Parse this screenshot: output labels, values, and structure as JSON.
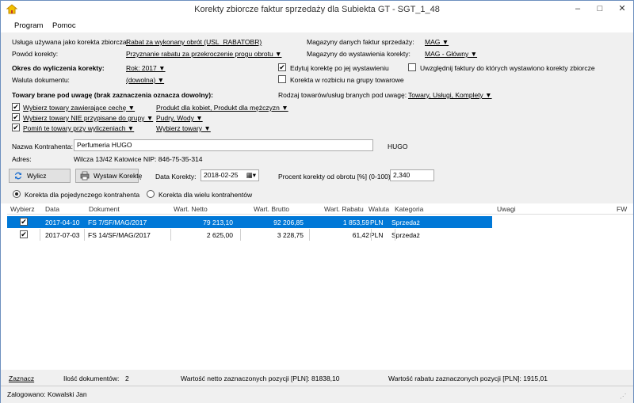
{
  "window": {
    "title": "Korekty zbiorcze faktur sprzedaży dla Subiekta GT - SGT_1_48",
    "minimize": "–",
    "maximize": "□",
    "close": "✕"
  },
  "menu": {
    "items": [
      "Program",
      "Pomoc"
    ]
  },
  "form": {
    "usluga_label": "Usługa używana jako korekta zbiorcza:",
    "usluga_value": "Rabat za wykonany obrót (USL_RABATOBR)",
    "powod_label": "Powód korekty:",
    "powod_value": "Przyznanie rabatu za przekroczenie progu obrotu ▼",
    "okres_label": "Okres do wyliczenia korekty:",
    "okres_value": "Rok: 2017 ▼",
    "waluta_label": "Waluta dokumentu:",
    "waluta_value": "(dowolna) ▼",
    "magazyny_danych_label": "Magazyny danych faktur sprzedaży:",
    "magazyny_danych_value": "MAG ▼",
    "magazyny_wyst_label": "Magazyny do wystawienia korekty:",
    "magazyny_wyst_value": "MAG - Główny ▼",
    "edytuj_label": "Edytuj korektę po jej wystawieniu",
    "edytuj_checked": true,
    "rozbicie_label": "Korekta w rozbiciu na grupy towarowe",
    "rozbicie_checked": false,
    "uwzglednij_label": "Uwzględnij faktury do których wystawiono korekty zbiorcze",
    "uwzglednij_checked": false,
    "towary_header": "Towary brane pod uwagę (brak zaznaczenia oznacza dowolny):",
    "rodzaj_label": "Rodzaj towarów/usług branych pod uwagę:",
    "rodzaj_value": "Towary, Usługi, Komplety ▼",
    "filters": [
      {
        "label": "Wybierz towary zawierające cechę ▼",
        "checked": true,
        "value": "Produkt dla kobiet, Produkt dla mężczyzn ▼"
      },
      {
        "label": "Wybierz towary NIE przypisane do grupy ▼",
        "checked": true,
        "value": "Pudry, Wody ▼"
      },
      {
        "label": "Pomiń te towary przy wyliczeniach ▼",
        "checked": true,
        "value": "Wybierz towary ▼"
      }
    ],
    "kontrahent_label": "Nazwa Kontrahenta:",
    "kontrahent_value": "Perfumeria HUGO",
    "kontrahent_code": "HUGO",
    "adres_label": "Adres:",
    "adres_value": "Wilcza  13/42  Katowice NIP: 846-75-35-314",
    "wylicz_label": "Wylicz",
    "wystaw_label": "Wystaw Korektę",
    "data_korekty_label": "Data Korekty:",
    "data_korekty_value": "2018-02-25",
    "procent_label": "Procent korekty od obrotu [%] (0-100):",
    "procent_value": "2,340",
    "radio_single": "Korekta dla pojedynczego kontrahenta",
    "radio_multi": "Korekta dla wielu kontrahentów"
  },
  "table": {
    "headers": [
      "Wybierz",
      "Data",
      "Dokument",
      "Wart. Netto",
      "Wart. Brutto",
      "Wart. Rabatu",
      "Waluta",
      "Kategoria",
      "Uwagi",
      "FW"
    ],
    "rows": [
      {
        "checked": true,
        "data": "2017-04-10",
        "dokument": "FS 7/SF/MAG/2017",
        "netto": "79 213,10",
        "brutto": "92 206,85",
        "rabat": "1 853,59",
        "waluta": "PLN",
        "kategoria": "Sprzedaż",
        "selected": true
      },
      {
        "checked": true,
        "data": "2017-07-03",
        "dokument": "FS 14/SF/MAG/2017",
        "netto": "2 625,00",
        "brutto": "3 228,75",
        "rabat": "61,42",
        "waluta": "PLN",
        "kategoria": "Sprzedaż",
        "selected": false
      }
    ]
  },
  "footer": {
    "zaznacz": "Zaznacz",
    "ilosc_label": "Ilość dokumentów:",
    "ilosc_value": "2",
    "netto_sum": "Wartość netto zaznaczonych pozycji [PLN]: 81838,10",
    "rabat_sum": "Wartość rabatu zaznaczonych pozycji [PLN]: 1915,01"
  },
  "status": {
    "user": "Zalogowano: Kowalski Jan"
  },
  "colors": {
    "selection": "#0078d7",
    "panel": "#f0f0f0",
    "border": "#6d8fbf"
  }
}
